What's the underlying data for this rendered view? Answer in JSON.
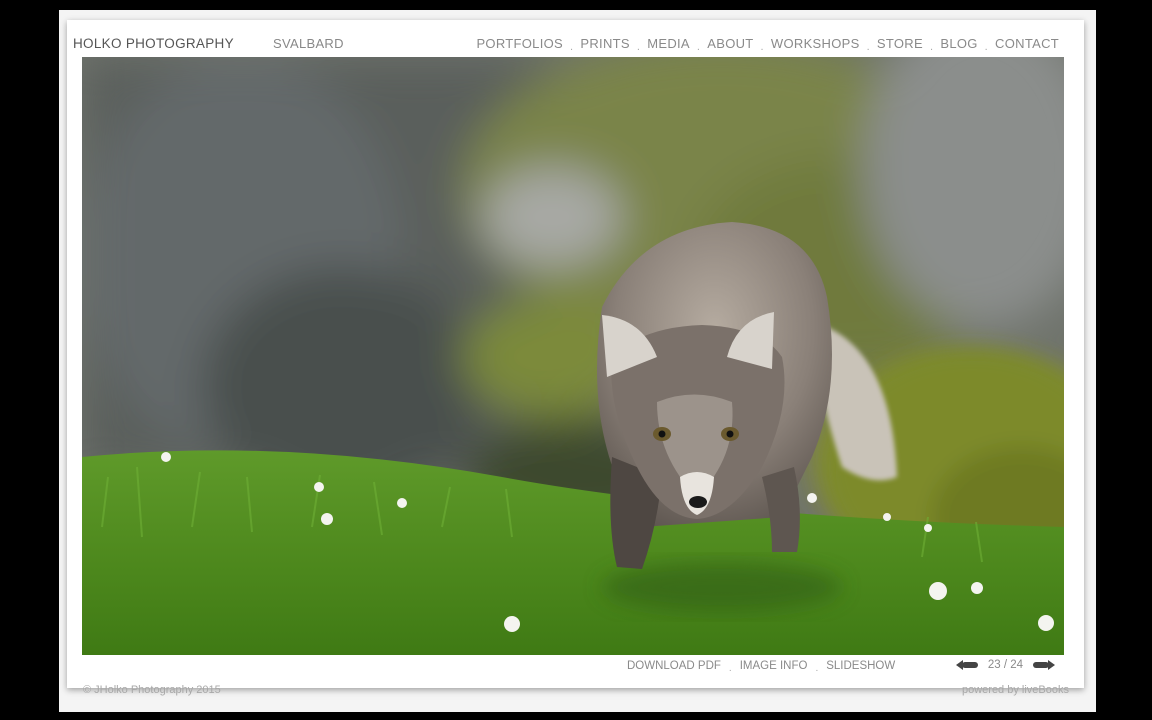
{
  "header": {
    "brand": "HOLKO PHOTOGRAPHY",
    "gallery": "SVALBARD",
    "nav": [
      {
        "label": "PORTFOLIOS"
      },
      {
        "label": "PRINTS"
      },
      {
        "label": "MEDIA"
      },
      {
        "label": "ABOUT"
      },
      {
        "label": "WORKSHOPS"
      },
      {
        "label": "STORE"
      },
      {
        "label": "BLOG"
      },
      {
        "label": "CONTACT"
      }
    ],
    "separator": "."
  },
  "photo": {
    "icon": "arctic-fox-photo"
  },
  "toolbar": {
    "download_pdf": "DOWNLOAD PDF",
    "image_info": "IMAGE INFO",
    "slideshow": "SLIDESHOW",
    "separator": ".",
    "counter": "23 / 24"
  },
  "footer": {
    "copyright": "© JHolko Photography 2015",
    "powered": "powered by liveBooks"
  },
  "colors": {
    "background": "#000000",
    "card": "#ffffff",
    "text": "#8a8a8a"
  }
}
